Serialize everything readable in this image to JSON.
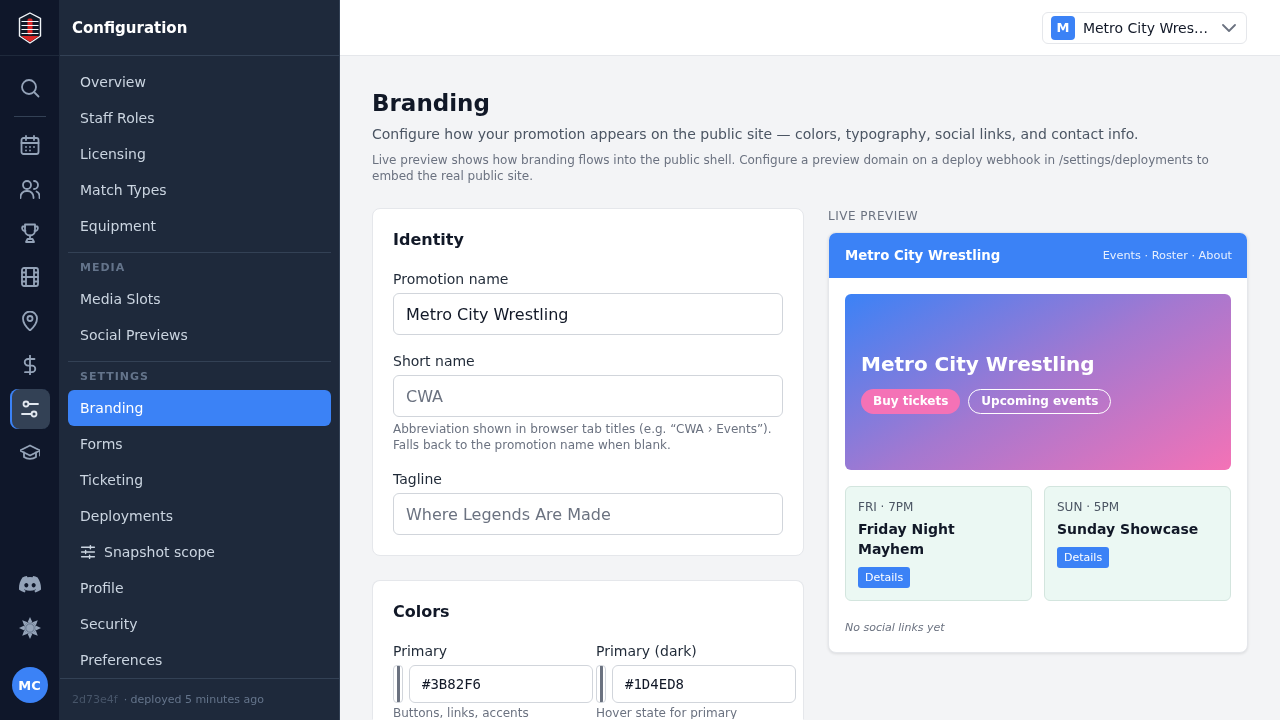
{
  "rail": {
    "sections": [
      {
        "items": [
          {
            "selected": false
          }
        ]
      },
      {
        "items": [
          {
            "selected": false
          },
          {
            "selected": false
          },
          {
            "selected": false
          },
          {
            "selected": false
          },
          {
            "selected": false
          },
          {
            "selected": false
          },
          {
            "selected": true
          },
          {
            "selected": false
          }
        ]
      }
    ],
    "avatar": "MC"
  },
  "sidebar": {
    "title": "Configuration",
    "sections": [
      {
        "items": [
          {
            "label": "Overview",
            "kind": "plain",
            "selected": false
          },
          {
            "label": "Staff Roles",
            "kind": "plain",
            "selected": false
          },
          {
            "label": "Licensing",
            "kind": "plain",
            "selected": false
          },
          {
            "label": "Match Types",
            "kind": "plain",
            "selected": false
          },
          {
            "label": "Equipment",
            "kind": "plain",
            "selected": false
          }
        ]
      },
      {
        "heading": "MEDIA",
        "items": [
          {
            "label": "Media Slots",
            "kind": "plain",
            "selected": false
          },
          {
            "label": "Social Previews",
            "kind": "plain",
            "selected": false
          }
        ]
      },
      {
        "heading": "SETTINGS",
        "items": [
          {
            "label": "Branding",
            "kind": "plain",
            "selected": true
          },
          {
            "label": "Forms",
            "kind": "plain",
            "selected": false
          },
          {
            "label": "Ticketing",
            "kind": "plain",
            "selected": false
          },
          {
            "label": "Deployments",
            "kind": "plain",
            "selected": false
          },
          {
            "label": "Snapshot scope",
            "kind": "icon",
            "selected": false
          },
          {
            "label": "Profile",
            "kind": "plain",
            "selected": false
          },
          {
            "label": "Security",
            "kind": "plain",
            "selected": false
          },
          {
            "label": "Preferences",
            "kind": "plain",
            "selected": false
          }
        ]
      }
    ],
    "footer": {
      "commit": "2d73e4f",
      "status": "· deployed 5 minutes ago"
    }
  },
  "topbar": {
    "switcher": {
      "badge": "M",
      "label": "Metro City Wres…"
    }
  },
  "page": {
    "title": "Branding",
    "subtitle": "Configure how your promotion appears on the public site — colors, typography, social links, and contact info.",
    "note": "Live preview shows how branding flows into the public shell. Configure a preview domain on a deploy webhook in /settings/deployments to embed the real public site."
  },
  "cards": [
    {
      "kind": "text-fields",
      "title": "Identity",
      "fields": [
        {
          "label": "Promotion name",
          "value": "Metro City Wrestling"
        },
        {
          "label": "Short name",
          "placeholder": "CWA",
          "hint": "Abbreviation shown in browser tab titles (e.g. “CWA › Events”). Falls back to the promotion name when blank."
        },
        {
          "label": "Tagline",
          "placeholder": "Where Legends Are Made"
        }
      ]
    },
    {
      "kind": "color-fields",
      "title": "Colors",
      "fields": [
        {
          "label": "Primary",
          "value": "#3B82F6",
          "hint": "Buttons, links, accents"
        },
        {
          "label": "Primary (dark)",
          "value": "#1D4ED8",
          "hint": "Hover state for primary"
        }
      ]
    }
  ],
  "preview": {
    "label": "LIVE PREVIEW",
    "site_title": "Metro City Wrestling",
    "nav": "Events · Roster · About",
    "hero": {
      "title": "Metro City Wrestling",
      "buttons": [
        {
          "label": "Buy tickets",
          "kind": "filled"
        },
        {
          "label": "Upcoming events",
          "kind": "outline"
        }
      ]
    },
    "events": [
      {
        "time": "FRI · 7PM",
        "title": "Friday Night Mayhem",
        "action": "Details"
      },
      {
        "time": "SUN · 5PM",
        "title": "Sunday Showcase",
        "action": "Details"
      }
    ],
    "social_note": "No social links yet"
  }
}
